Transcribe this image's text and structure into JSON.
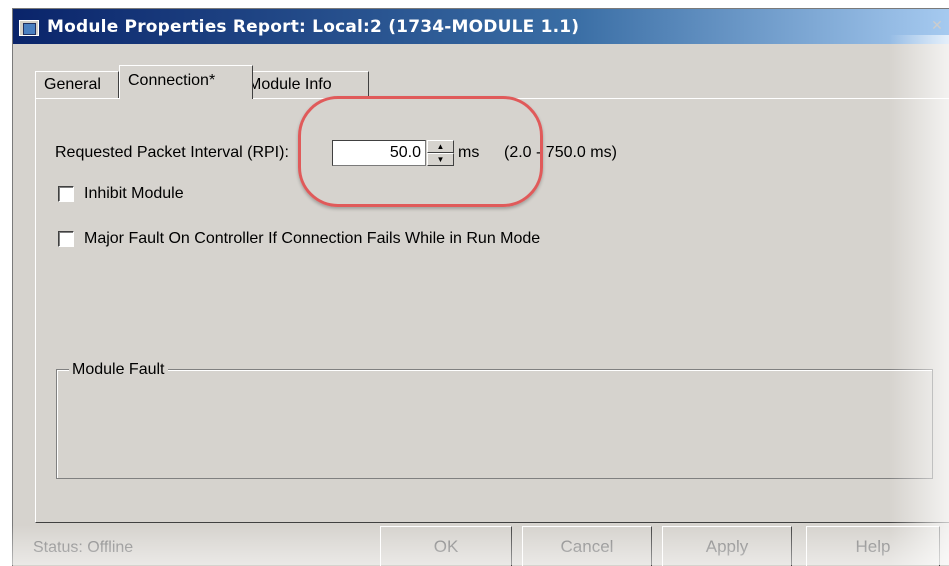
{
  "window": {
    "title": "Module Properties Report: Local:2 (1734-MODULE 1.1)",
    "close_glyph": "✕"
  },
  "tabs": [
    {
      "label": "General",
      "active": false
    },
    {
      "label": "Connection*",
      "active": true
    },
    {
      "label": "Module Info",
      "active": false
    }
  ],
  "connection": {
    "rpi_label": "Requested Packet Interval (RPI):",
    "rpi_value": "50.0",
    "rpi_unit": "ms",
    "rpi_range": "(2.0 - 750.0 ms)",
    "inhibit_label": "Inhibit Module",
    "inhibit_checked": false,
    "major_fault_label": "Major Fault On Controller If Connection Fails While in Run Mode",
    "major_fault_checked": false,
    "module_fault_legend": "Module Fault"
  },
  "status": {
    "text": "Status:  Offline"
  },
  "buttons": {
    "ok": "OK",
    "cancel": "Cancel",
    "apply": "Apply",
    "help": "Help"
  },
  "colors": {
    "title_gradient_start": "#0a246a",
    "dialog_background": "#d6d3ce",
    "highlight_annotation": "#e05a5a"
  },
  "icons": {
    "window": "module-window-icon",
    "spin_up": "▲",
    "spin_down": "▼"
  }
}
